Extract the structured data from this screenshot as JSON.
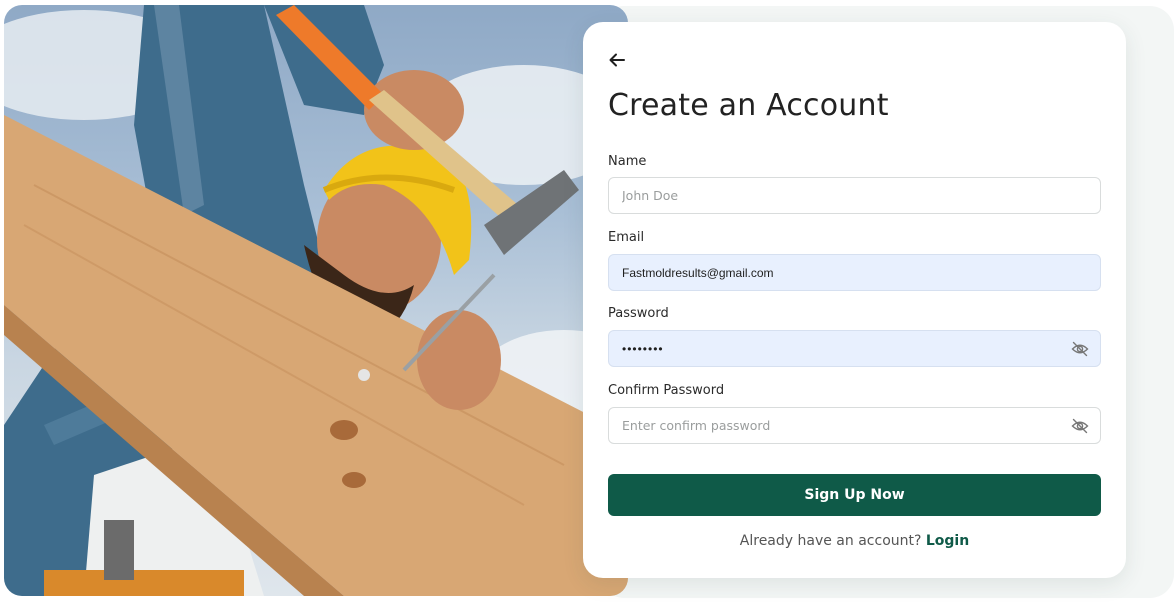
{
  "form": {
    "title": "Create an Account",
    "fields": {
      "name": {
        "label": "Name",
        "placeholder": "John Doe",
        "value": ""
      },
      "email": {
        "label": "Email",
        "placeholder": "",
        "value": "Fastmoldresults@gmail.com"
      },
      "password": {
        "label": "Password",
        "placeholder": "",
        "value": "••••••••"
      },
      "confirm_password": {
        "label": "Confirm Password",
        "placeholder": "Enter confirm password",
        "value": ""
      }
    },
    "submit_label": "Sign Up Now",
    "footer": {
      "prompt": "Already have an account? ",
      "login_label": "Login"
    }
  },
  "icons": {
    "back": "arrow-left-icon",
    "password_toggle": "eye-off-icon",
    "confirm_toggle": "eye-off-icon"
  },
  "colors": {
    "primary": "#0f5a48",
    "autofill_bg": "#e8f0fe",
    "text": "#222222",
    "muted": "#9a9d9d"
  }
}
